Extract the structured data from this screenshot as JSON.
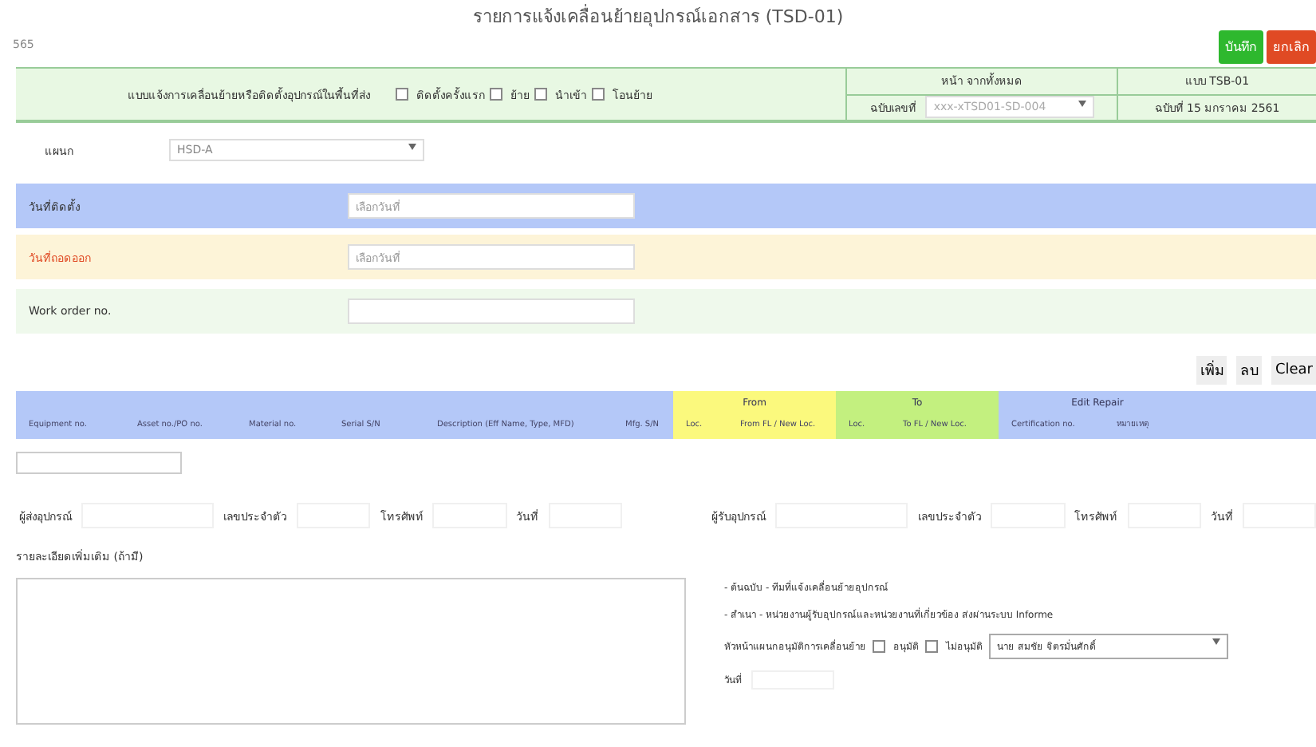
{
  "title": "รายการแจ้งเคลื่อนย้ายอุปกรณ์เอกสาร (TSD-01)",
  "doc_id": "565",
  "actions": [
    {
      "label": "บันทึก",
      "kind": "save"
    },
    {
      "label": "ยกเลิก",
      "kind": "cancel"
    }
  ],
  "header": {
    "form_label": "แบบแจ้งการเคลื่อนย้ายหรือติดตั้งอุปกรณ์ในพื้นที่ส่ง",
    "options": [
      {
        "label": "ติดตั้งครั้งแรก",
        "checked": false
      },
      {
        "label": "ย้าย",
        "checked": false
      },
      {
        "label": "นำเข้า",
        "checked": false
      },
      {
        "label": "โอนย้าย",
        "checked": false
      }
    ],
    "page_label": "หน้า จากทั้งหมด",
    "doc_no_label": "ฉบับเลขที่",
    "doc_no_value": "xxx-xTSD01-SD-004",
    "form_code": "แบบ TSB-01",
    "issue_date": "ฉบับที่ 15 มกราคม 2561"
  },
  "department": {
    "label": "แผนก",
    "value": "HSD-A"
  },
  "date_rows": [
    {
      "label": "วันที่ติดตั้ง",
      "placeholder": "เลือกวันที่",
      "kind": "install"
    },
    {
      "label": "วันที่ถอดออก",
      "placeholder": "เลือกวันที่",
      "kind": "remove"
    },
    {
      "label": "Work order no.",
      "kind": "workorder"
    }
  ],
  "table_buttons": [
    "เพิ่ม",
    "ลบ",
    "Clear"
  ],
  "table": {
    "columns": [
      {
        "label": "Equipment no.",
        "kind": "plain"
      },
      {
        "label": "Asset no./PO no.",
        "kind": "plain"
      },
      {
        "label": "Material no.",
        "kind": "plain"
      },
      {
        "label": "Serial S/N",
        "kind": "plain"
      },
      {
        "label": "Description (Eff Name, Type, MFD)",
        "kind": "plain"
      },
      {
        "label": "Mfg. S/N",
        "kind": "plain"
      },
      {
        "label": "Loc.",
        "kind": "from"
      },
      {
        "label": "From FL / New Loc.",
        "kind": "from"
      },
      {
        "label": "Loc.",
        "kind": "to"
      },
      {
        "label": "To FL / New Loc.",
        "kind": "to"
      },
      {
        "label": "Certification no.",
        "kind": "repair"
      },
      {
        "label": "หมายเหตุ",
        "kind": "repair"
      }
    ],
    "groups": [
      {
        "label": "From",
        "kind": "from"
      },
      {
        "label": "To",
        "kind": "to"
      },
      {
        "label": "Edit Repair",
        "kind": "repair"
      }
    ]
  },
  "signatures": [
    {
      "label": "ผู้ส่งอุปกรณ์"
    },
    {
      "label": "เลขประจำตัว"
    },
    {
      "label": "โทรศัพท์"
    },
    {
      "label": "วันที่"
    },
    {
      "label": "ผู้รับอุปกรณ์"
    },
    {
      "label": "เลขประจำตัว"
    },
    {
      "label": "โทรศัพท์"
    },
    {
      "label": "วันที่"
    }
  ],
  "notes_label": "รายละเอียดเพิ่มเติม (ถ้ามี)",
  "distribution": [
    "- ต้นฉบับ - ทีมที่แจ้งเคลื่อนย้ายอุปกรณ์",
    "- สำเนา - หน่วยงานผู้รับอุปกรณ์และหน่วยงานที่เกี่ยวข้อง ส่งผ่านระบบ Informe"
  ],
  "approval": {
    "label": "หัวหน้าแผนกอนุมัติการเคลื่อนย้าย",
    "options": [
      {
        "label": "อนุมัติ",
        "checked": false
      },
      {
        "label": "ไม่อนุมัติ",
        "checked": false
      }
    ],
    "approver": "นาย สมชัย จิตรมั่นศักดิ์",
    "date_label": "วันที่"
  }
}
